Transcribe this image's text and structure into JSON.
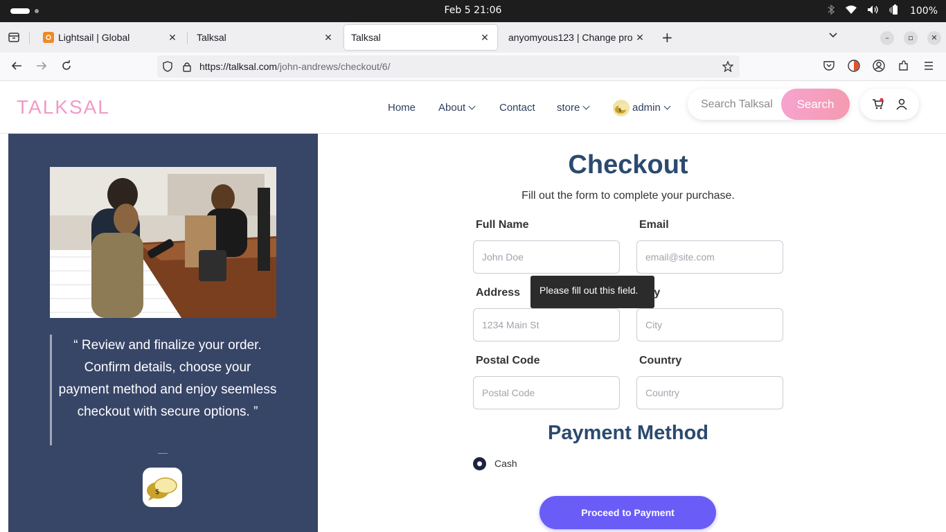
{
  "os": {
    "datetime": "Feb 5  21:06",
    "battery": "100%"
  },
  "browser": {
    "tabs": [
      {
        "title": "Lightsail | Global",
        "active": false
      },
      {
        "title": "Talksal",
        "active": false
      },
      {
        "title": "Talksal",
        "active": true
      },
      {
        "title": "anyomyous123 | Change pro",
        "active": false
      }
    ],
    "url_domain": "https://talksal.com",
    "url_path": "/john-andrews/checkout/6/"
  },
  "site": {
    "logo": "TALKSAL",
    "nav": {
      "home": "Home",
      "about": "About",
      "contact": "Contact",
      "store": "store",
      "user": "admin"
    },
    "search": {
      "placeholder": "Search Talksal",
      "button": "Search"
    }
  },
  "left_panel": {
    "quote": "“ Review and finalize your order. Confirm details, choose your payment method and enjoy seemless checkout with secure options. ”"
  },
  "checkout": {
    "title": "Checkout",
    "subtitle": "Fill out the form to complete your purchase.",
    "fields": {
      "full_name": {
        "label": "Full Name",
        "placeholder": "John Doe"
      },
      "email": {
        "label": "Email",
        "placeholder": "email@site.com"
      },
      "address": {
        "label": "Address",
        "placeholder": "1234 Main St"
      },
      "city": {
        "label": "City",
        "placeholder": "City"
      },
      "postal_code": {
        "label": "Postal Code",
        "placeholder": "Postal Code"
      },
      "country": {
        "label": "Country",
        "placeholder": "Country"
      }
    },
    "validation_tooltip": "Please fill out this field.",
    "payment_title": "Payment Method",
    "payment_option": "Cash",
    "proceed_button": "Proceed to Payment"
  },
  "colors": {
    "brand_pink": "#f29ac8",
    "panel_navy": "#374567",
    "heading_blue": "#2b4a6e",
    "button_purple": "#6a5cf6"
  }
}
